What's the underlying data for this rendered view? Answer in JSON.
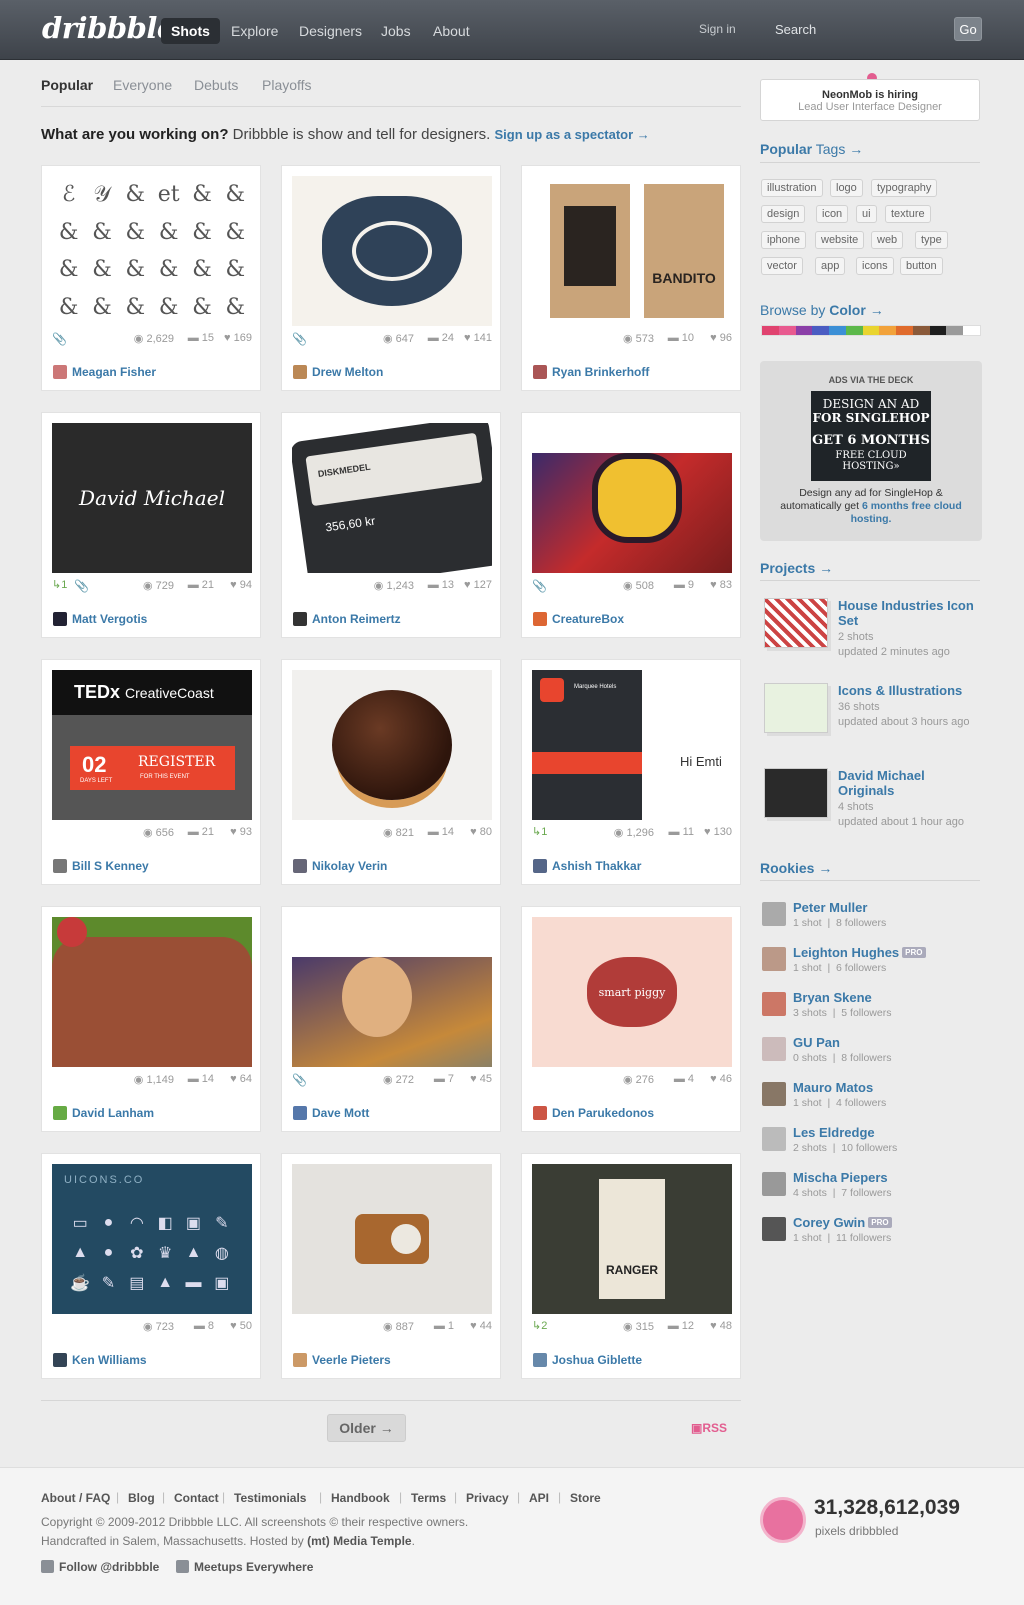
{
  "header": {
    "logo": "dribbble",
    "nav": [
      "Shots",
      "Explore",
      "Designers",
      "Jobs",
      "About"
    ],
    "signin": "Sign in",
    "search_placeholder": "Search",
    "go": "Go"
  },
  "subnav": [
    "Popular",
    "Everyone",
    "Debuts",
    "Playoffs"
  ],
  "tagline": {
    "bold": "What are you working on?",
    "rest": " Dribbble is show and tell for designers.",
    "link": "Sign up as a spectator →"
  },
  "shots": [
    {
      "views": "2,629",
      "comments": "15",
      "likes": "169",
      "player": "Meagan Fisher",
      "attach": true,
      "rebound": ""
    },
    {
      "views": "647",
      "comments": "24",
      "likes": "141",
      "player": "Drew Melton",
      "attach": true,
      "rebound": ""
    },
    {
      "views": "573",
      "comments": "10",
      "likes": "96",
      "player": "Ryan Brinkerhoff",
      "attach": false,
      "rebound": ""
    },
    {
      "views": "729",
      "comments": "21",
      "likes": "94",
      "player": "Matt Vergotis",
      "attach": true,
      "rebound": "1"
    },
    {
      "views": "1,243",
      "comments": "13",
      "likes": "127",
      "player": "Anton Reimertz",
      "attach": false,
      "rebound": ""
    },
    {
      "views": "508",
      "comments": "9",
      "likes": "83",
      "player": "CreatureBox",
      "attach": true,
      "rebound": ""
    },
    {
      "views": "656",
      "comments": "21",
      "likes": "93",
      "player": "Bill S Kenney",
      "attach": false,
      "rebound": ""
    },
    {
      "views": "821",
      "comments": "14",
      "likes": "80",
      "player": "Nikolay Verin",
      "attach": false,
      "rebound": ""
    },
    {
      "views": "1,296",
      "comments": "11",
      "likes": "130",
      "player": "Ashish Thakkar",
      "attach": false,
      "rebound": "1"
    },
    {
      "views": "1,149",
      "comments": "14",
      "likes": "64",
      "player": "David Lanham",
      "attach": false,
      "rebound": ""
    },
    {
      "views": "272",
      "comments": "7",
      "likes": "45",
      "player": "Dave Mott",
      "attach": true,
      "rebound": ""
    },
    {
      "views": "276",
      "comments": "4",
      "likes": "46",
      "player": "Den Parukedonos",
      "attach": false,
      "rebound": ""
    },
    {
      "views": "723",
      "comments": "8",
      "likes": "50",
      "player": "Ken Williams",
      "attach": false,
      "rebound": ""
    },
    {
      "views": "887",
      "comments": "1",
      "likes": "44",
      "player": "Veerle Pieters",
      "attach": false,
      "rebound": ""
    },
    {
      "views": "315",
      "comments": "12",
      "likes": "48",
      "player": "Joshua Giblette",
      "attach": false,
      "rebound": "2"
    }
  ],
  "thumb_text": {
    "ted_title": "TEDx",
    "ted_sub": "CreativeCoast",
    "ted_days": "02",
    "ted_days_label": "DAYS LEFT",
    "ted_register": "REGISTER",
    "ted_event": "FOR THIS EVENT",
    "david": "David Michael",
    "uicons": "UICONS.CO",
    "ranger": "RANGER",
    "piggy": "smart piggy",
    "bandito": "BANDITO",
    "diskmedel": "DISKMEDEL",
    "price": "356,60 kr",
    "hotel": "Marquee Hotels",
    "hi": "Hi Emti"
  },
  "sidebar": {
    "hiring_title": "NeonMob is hiring",
    "hiring_sub": "Lead User Interface Designer",
    "popular_tags_a": "Popular",
    "popular_tags_b": " Tags →",
    "tags": [
      "illustration",
      "logo",
      "typography",
      "design",
      "icon",
      "ui",
      "texture",
      "iphone",
      "website",
      "web",
      "type",
      "vector",
      "app",
      "icons",
      "button"
    ],
    "browse_a": "Browse by ",
    "browse_b": "Color →",
    "colors": [
      "#e0436f",
      "#e85a8f",
      "#8b3fa8",
      "#4a5cc2",
      "#3b8fd6",
      "#5cb84a",
      "#e9d42f",
      "#f2a23a",
      "#e06b2c",
      "#8a5a3a",
      "#1e1e1e",
      "#9a9a9a",
      "#ffffff"
    ],
    "ad_label": "ADS VIA THE DECK",
    "ad_line1": "DESIGN AN AD",
    "ad_line2": "FOR SINGLEHOP",
    "ad_line3": "GET 6 MONTHS",
    "ad_line4": "FREE CLOUD HOSTING»",
    "ad_text": "Design any ad for SingleHop & automatically get",
    "ad_link": "6 months free cloud hosting.",
    "projects_head": "Projects →",
    "projects": [
      {
        "title": "House Industries Icon Set",
        "shots": "2 shots",
        "updated": "updated 2 minutes ago"
      },
      {
        "title": "Icons & Illustrations",
        "shots": "36 shots",
        "updated": "updated about 3 hours ago"
      },
      {
        "title": "David Michael Originals",
        "shots": "4 shots",
        "updated": "updated about 1 hour ago"
      }
    ],
    "rookies_head": "Rookies →",
    "rookies": [
      {
        "name": "Peter Muller",
        "shots": "1 shot",
        "followers": "8 followers",
        "pro": false
      },
      {
        "name": "Leighton Hughes",
        "shots": "1 shot",
        "followers": "6 followers",
        "pro": true
      },
      {
        "name": "Bryan Skene",
        "shots": "3 shots",
        "followers": "5 followers",
        "pro": false
      },
      {
        "name": "GU Pan",
        "shots": "0 shots",
        "followers": "8 followers",
        "pro": false
      },
      {
        "name": "Mauro Matos",
        "shots": "1 shot",
        "followers": "4 followers",
        "pro": false
      },
      {
        "name": "Les Eldredge",
        "shots": "2 shots",
        "followers": "10 followers",
        "pro": false
      },
      {
        "name": "Mischa Piepers",
        "shots": "4 shots",
        "followers": "7 followers",
        "pro": false
      },
      {
        "name": "Corey Gwin",
        "shots": "1 shot",
        "followers": "11 followers",
        "pro": true
      }
    ],
    "pro_label": "PRO"
  },
  "pager": {
    "older": "Older →",
    "rss": "RSS"
  },
  "footer": {
    "links": [
      "About / FAQ",
      "Blog",
      "Contact",
      "Testimonials",
      "Handbook",
      "Terms",
      "Privacy",
      "API",
      "Store"
    ],
    "copyright": "Copyright © 2009-2012 Dribbble LLC. All screenshots © their respective owners.",
    "hand_a": "Handcrafted in Salem, Massachusetts. Hosted by ",
    "hand_b": "(mt) Media Temple",
    "follow": "Follow @dribbble",
    "meetups": "Meetups Everywhere",
    "pixels": "31,328,612,039",
    "pixels_label": "pixels dribbbled"
  }
}
